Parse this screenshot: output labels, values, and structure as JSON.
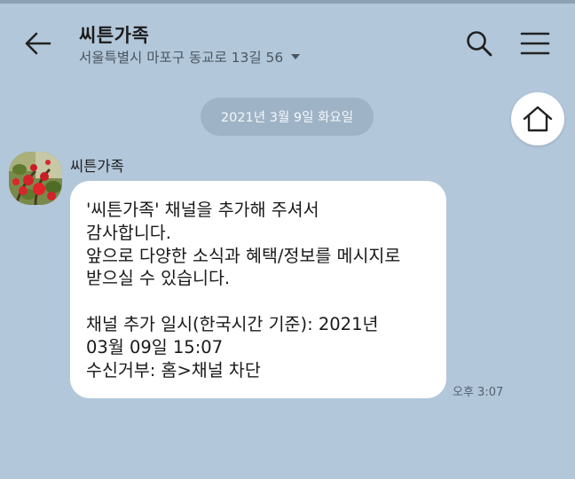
{
  "header": {
    "title": "씨튼가족",
    "subtitle": "서울특별시 마포구 동교로 13길 56"
  },
  "chat": {
    "date": "2021년 3월 9일 화요일",
    "message": {
      "sender": "씨튼가족",
      "lines": [
        "'씨튼가족' 채널을 추가해 주셔서",
        "감사합니다.",
        "앞으로 다양한 소식과 혜택/정보를 메시지로",
        "받으실 수 있습니다.",
        "",
        "채널 추가 일시(한국시간 기준): 2021년",
        "03월 09일 15:07",
        "수신거부: 홈>채널 차단"
      ],
      "time": "오후 3:07"
    }
  },
  "icons": {
    "back": "arrow-left-icon",
    "search": "search-icon",
    "menu": "hamburger-menu-icon",
    "home": "home-icon",
    "avatar": "flower-photo"
  },
  "colors": {
    "background": "#b2c7da",
    "bubble": "#ffffff",
    "date_pill": "#9fb3c7"
  }
}
